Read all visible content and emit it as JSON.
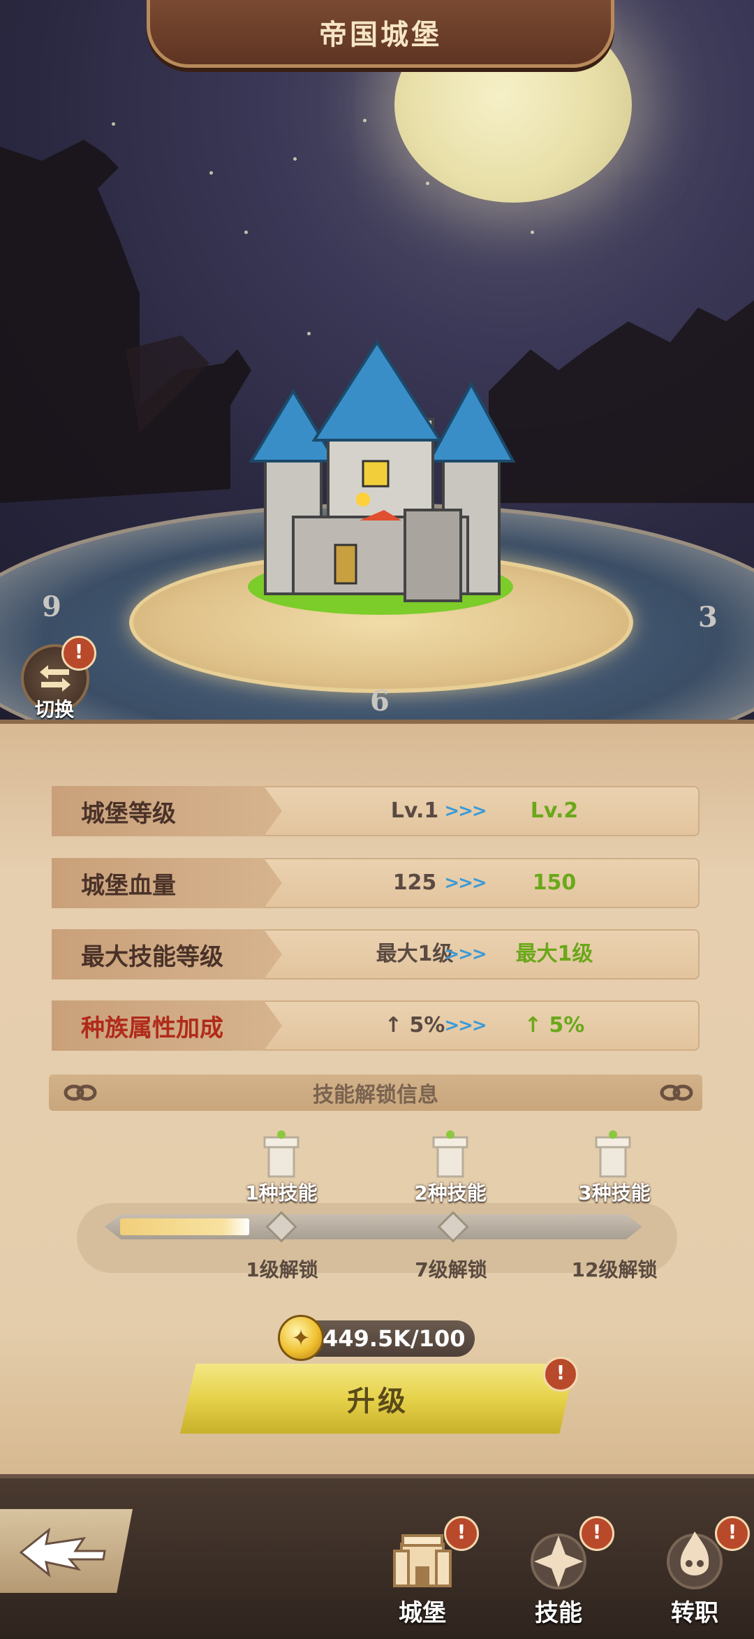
{
  "header": {
    "title": "帝国城堡"
  },
  "scene": {
    "switch_label": "切换",
    "dial_numbers": [
      "9",
      "3",
      "6"
    ]
  },
  "stats": [
    {
      "label": "城堡等级",
      "current": "Lv.1",
      "arrow": ">>>",
      "next": "Lv.2",
      "highlight": false
    },
    {
      "label": "城堡血量",
      "current": "125",
      "arrow": ">>>",
      "next": "150",
      "highlight": false
    },
    {
      "label": "最大技能等级",
      "current": "最大1级",
      "arrow": ">>>",
      "next": "最大1级",
      "highlight": false
    },
    {
      "label": "种族属性加成",
      "current": "↑ 5%",
      "arrow": ">>>",
      "next": "↑ 5%",
      "highlight": true
    }
  ],
  "unlock": {
    "title": "技能解锁信息",
    "skills": [
      "1种技能",
      "2种技能",
      "3种技能"
    ],
    "levels": [
      "1级解锁",
      "7级解锁",
      "12级解锁"
    ],
    "progress_fraction": 0.25
  },
  "cost": {
    "text": "449.5K/100",
    "coin_icon": "gold-coin-icon"
  },
  "upgrade": {
    "label": "升级"
  },
  "alert_mark": "!",
  "nav": {
    "items": [
      {
        "label": "城堡",
        "icon": "castle-icon"
      },
      {
        "label": "技能",
        "icon": "skill-icon"
      },
      {
        "label": "转职",
        "icon": "class-change-icon"
      }
    ]
  },
  "colors": {
    "next_value": "#6aa81a",
    "arrow": "#3a9ad8",
    "red_label": "#b02a1a",
    "upgrade_button": "#e6d24a",
    "alert_badge": "#b8492a"
  }
}
